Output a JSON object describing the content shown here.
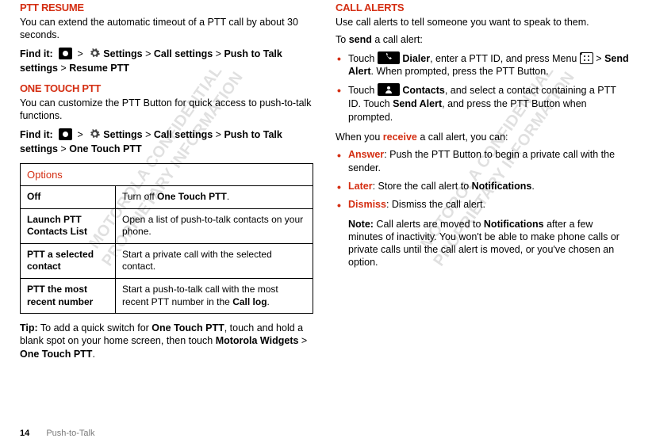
{
  "left": {
    "sec1": {
      "title": "PTT RESUME",
      "body": "You can extend the automatic timeout of a PTT call by about 30 seconds.",
      "findit_label": "Find it:",
      "path": {
        "settings": "Settings",
        "call": "Call settings",
        "ptt": "Push to Talk settings",
        "resume": "Resume PTT"
      }
    },
    "sec2": {
      "title": "ONE TOUCH PTT",
      "body": "You can customize the PTT Button for quick access to push-to-talk functions.",
      "findit_label": "Find it:",
      "path": {
        "settings": "Settings",
        "call": "Call settings",
        "ptt": "Push to Talk settings",
        "one": "One Touch PTT"
      },
      "table_header": "Options",
      "rows": [
        {
          "k": "Off",
          "v_pre": "Turn off ",
          "v_b": "One Touch PTT",
          "v_post": "."
        },
        {
          "k": "Launch PTT Contacts List",
          "v": "Open a list of push-to-talk contacts on your phone."
        },
        {
          "k": "PTT a selected contact",
          "v": "Start a private call with the selected contact."
        },
        {
          "k": "PTT the most recent number",
          "v_pre": "Start a push-to-talk call with the most recent PTT number in the ",
          "v_b": "Call log",
          "v_post": "."
        }
      ],
      "tip_label": "Tip:",
      "tip_pre": " To add a quick switch for ",
      "tip_b1": "One Touch PTT",
      "tip_mid": ", touch and hold a blank spot on your home screen, then touch ",
      "tip_b2": "Motorola Widgets",
      "tip_gt": " > ",
      "tip_b3": "One Touch PTT",
      "tip_post": "."
    }
  },
  "right": {
    "title": "CALL ALERTS",
    "intro": "Use call alerts to tell someone you want to speak to them.",
    "send_pre": "To ",
    "send_b": "send",
    "send_post": " a call alert:",
    "bullets_send": [
      {
        "pre": "Touch ",
        "b1": "Dialer",
        "mid1": ", enter a PTT ID, and press Menu ",
        "gt": " > ",
        "b2": "Send Alert",
        "mid2": ". When prompted, press the PTT Button."
      },
      {
        "pre": "Touch ",
        "b1": "Contacts",
        "mid1": ", and select a contact containing a PTT ID. Touch ",
        "b2": "Send Alert",
        "mid2": ", and press the PTT Button when prompted."
      }
    ],
    "recv_pre": "When you ",
    "recv_accent": "receive",
    "recv_post": " a call alert, you can:",
    "bullets_recv": [
      {
        "accent": "Answer",
        "text": ": Push the PTT Button to begin a private call with the sender."
      },
      {
        "accent": "Later",
        "pre": ": Store the call alert to ",
        "b": "Notifications",
        "post": "."
      },
      {
        "accent": "Dismiss",
        "text": ": Dismiss the call alert."
      }
    ],
    "note_label": "Note:",
    "note_pre": " Call alerts are moved to ",
    "note_b": "Notifications",
    "note_post": " after a few minutes of inactivity. You won't be able to make phone calls or private calls until the call alert is moved, or you've chosen an option."
  },
  "footer": {
    "page": "14",
    "section": "Push-to-Talk"
  },
  "wm": "MOTOROLA CONFIDENTIAL\nPROPRIETARY INFORMATION"
}
